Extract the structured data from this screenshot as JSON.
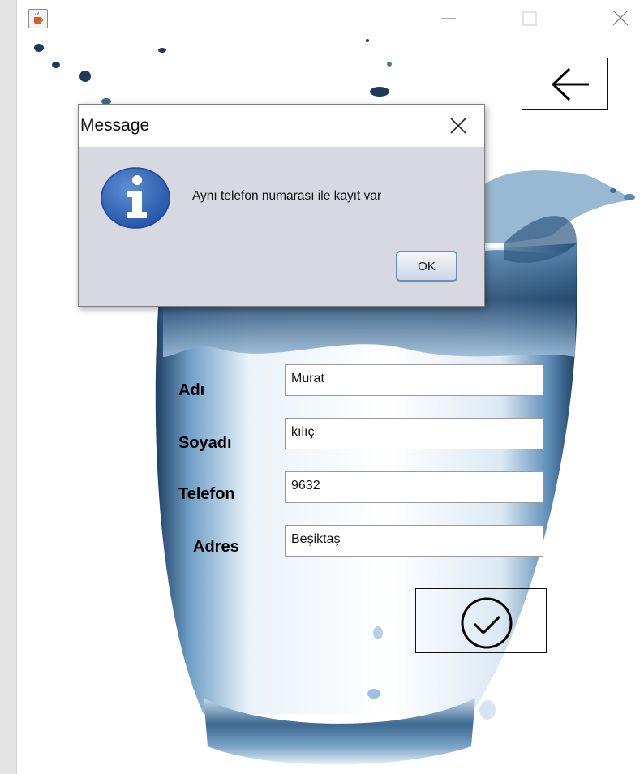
{
  "form": {
    "fields": [
      {
        "label": "Adı",
        "value": "Murat"
      },
      {
        "label": "Soyadı",
        "value": "kılıç"
      },
      {
        "label": "Telefon",
        "value": "9632"
      },
      {
        "label": "Adres",
        "value": "Beşiktaş"
      }
    ]
  },
  "dialog": {
    "title": "Message",
    "message": "Aynı telefon numarası ile kayıt var",
    "ok_label": "OK",
    "icon": "info-icon"
  },
  "icons": {
    "app": "java-cup-icon",
    "back": "arrow-left-icon",
    "confirm": "check-circle-icon",
    "minimize": "minimize-icon",
    "maximize": "maximize-icon",
    "close": "close-icon"
  },
  "colors": {
    "water_dark": "#1b3f63",
    "water_mid": "#6f9fc6",
    "dialog_bg": "#d8d9e0",
    "info_blue": "#2f64b8"
  }
}
